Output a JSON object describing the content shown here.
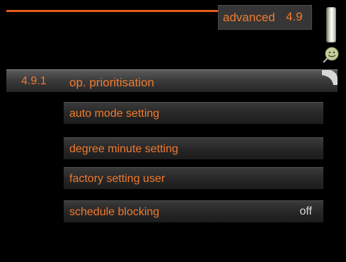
{
  "header": {
    "title": "advanced",
    "number": "4.9"
  },
  "icons": {
    "thermometer": "thermometer-icon",
    "status": "smiley-status-icon"
  },
  "menu": {
    "selected_index": "4.9.1",
    "items": [
      {
        "label": "op. prioritisation",
        "value": ""
      },
      {
        "label": "auto mode setting",
        "value": ""
      },
      {
        "label": "degree minute setting",
        "value": ""
      },
      {
        "label": "factory setting user",
        "value": ""
      },
      {
        "label": "schedule blocking",
        "value": "off"
      }
    ]
  },
  "colors": {
    "accent": "#f07a2e",
    "background": "#000000"
  }
}
